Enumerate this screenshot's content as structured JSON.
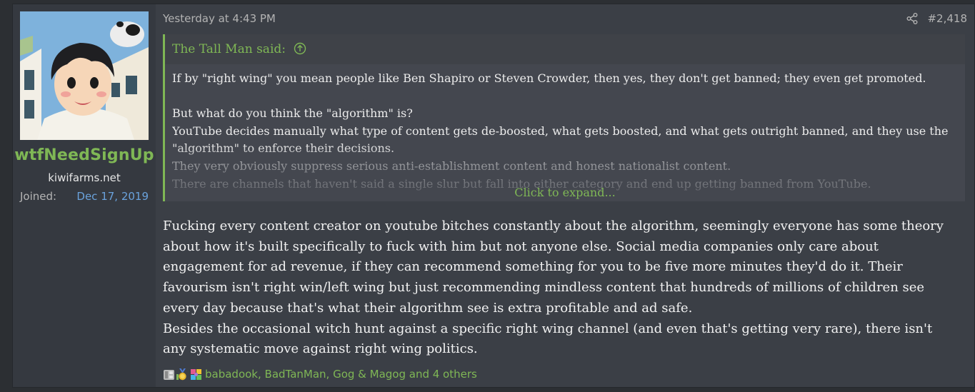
{
  "post": {
    "date": "Yesterday at 4:43 PM",
    "number": "#2,418",
    "author": {
      "username": "wtfNeedSignUp",
      "title": "kiwifarms.net",
      "joined_label": "Joined:",
      "joined_value": "Dec 17, 2019",
      "username_color": "#7fb755"
    },
    "quote": {
      "attribution": "The Tall Man said:",
      "paragraphs": [
        "If by \"right wing\" you mean people like Ben Shapiro or Steven Crowder, then yes, they don't get banned; they even get promoted.",
        "But what do you think the \"algorithm\" is?",
        "YouTube decides manually what type of content gets de-boosted, what gets boosted, and what gets outright banned, and they use the \"algorithm\" to enforce their decisions.",
        "They very obviously suppress serious anti-establishment content and honest nationalist content.",
        "There are channels that haven't said a single slur but fall into either category and end up getting banned from YouTube."
      ],
      "expand_label": "Click to expand..."
    },
    "body": {
      "paragraphs": [
        "Fucking every content creator on youtube bitches constantly about the algorithm, seemingly everyone has some theory about how it's built specifically to fuck with him but not anyone else. Social media companies only care about engagement for ad revenue, if they can recommend something for you to be five more minutes they'd do it. Their favourism isn't right win/left wing but just recommending mindless content that hundreds of millions of children see every day because that's what their algorithm see is extra profitable and ad safe.",
        "Besides the occasional witch hunt against a specific right wing channel (and even that's getting very rare), there isn't any systematic move against right wing politics."
      ]
    },
    "reactions": {
      "icons": [
        "grey-block-reaction-icon",
        "gold-medal-reaction-icon",
        "rainbow-puzzle-reaction-icon"
      ],
      "list": "babadook, BadTanMan, Gog & Magog and 4 others"
    }
  },
  "colors": {
    "accent_green": "#7fb755",
    "link_blue": "#6aa2dc",
    "background": "#2c2f33",
    "post_background": "#3b3f46"
  }
}
